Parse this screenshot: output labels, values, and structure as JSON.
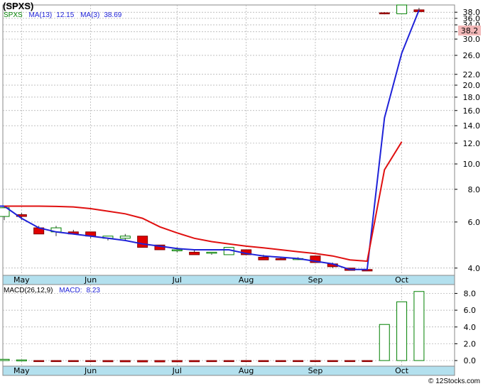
{
  "header": {
    "symbol": "(SPXS)",
    "legend_symbol": "SPXS",
    "ma13_label": "MA(13)",
    "ma13_value": "12.15",
    "ma3_label": "MA(3)",
    "ma3_value": "38.69"
  },
  "macd_header": {
    "label": "MACD(26,12,9)",
    "macd_label": "MACD:",
    "macd_value": "8.23"
  },
  "price_badge": "38.2",
  "credit": "© 12Stocks.com",
  "colors": {
    "up": "#ffffff",
    "up_border": "#008000",
    "down": "#e00000",
    "ma13": "#e01010",
    "ma3": "#1f22d8",
    "axis_band": "#b3e0ee",
    "grid": "#aaaaaa",
    "badge_bg": "#f2b8b8"
  },
  "chart_data": [
    {
      "type": "candlestick",
      "title": "(SPXS)",
      "y_scale": "log",
      "ylim": [
        3.8,
        40
      ],
      "y_ticks": [
        4.0,
        6.0,
        8.0,
        10.0,
        12.0,
        14.0,
        16.0,
        18.0,
        20.0,
        22.0,
        26.0,
        30.0,
        32.0,
        34.0,
        36.0,
        38.0
      ],
      "x_labels": [
        "May",
        "Jun",
        "Jul",
        "Aug",
        "Sep",
        "Oct"
      ],
      "x_label_index": [
        1,
        5,
        10,
        14,
        18,
        23
      ],
      "grid": "dashed",
      "candles": [
        {
          "o": 6.3,
          "h": 6.9,
          "l": 6.1,
          "c": 6.8
        },
        {
          "o": 6.4,
          "h": 6.5,
          "l": 6.1,
          "c": 6.3
        },
        {
          "o": 5.7,
          "h": 5.8,
          "l": 5.4,
          "c": 5.4
        },
        {
          "o": 5.5,
          "h": 5.8,
          "l": 5.3,
          "c": 5.7
        },
        {
          "o": 5.5,
          "h": 5.6,
          "l": 5.4,
          "c": 5.4
        },
        {
          "o": 5.5,
          "h": 5.5,
          "l": 5.2,
          "c": 5.3
        },
        {
          "o": 5.2,
          "h": 5.3,
          "l": 5.1,
          "c": 5.3
        },
        {
          "o": 5.2,
          "h": 5.4,
          "l": 5.1,
          "c": 5.3
        },
        {
          "o": 5.3,
          "h": 5.3,
          "l": 4.8,
          "c": 4.8
        },
        {
          "o": 4.9,
          "h": 4.9,
          "l": 4.7,
          "c": 4.7
        },
        {
          "o": 4.7,
          "h": 4.8,
          "l": 4.6,
          "c": 4.7
        },
        {
          "o": 4.6,
          "h": 4.7,
          "l": 4.5,
          "c": 4.5
        },
        {
          "o": 4.6,
          "h": 4.6,
          "l": 4.5,
          "c": 4.6
        },
        {
          "o": 4.5,
          "h": 4.8,
          "l": 4.5,
          "c": 4.8
        },
        {
          "o": 4.7,
          "h": 4.7,
          "l": 4.5,
          "c": 4.5
        },
        {
          "o": 4.4,
          "h": 4.5,
          "l": 4.3,
          "c": 4.3
        },
        {
          "o": 4.35,
          "h": 4.4,
          "l": 4.3,
          "c": 4.3
        },
        {
          "o": 4.35,
          "h": 4.4,
          "l": 4.3,
          "c": 4.35
        },
        {
          "o": 4.45,
          "h": 4.45,
          "l": 4.2,
          "c": 4.2
        },
        {
          "o": 4.15,
          "h": 4.2,
          "l": 4.0,
          "c": 4.05
        },
        {
          "o": 4.0,
          "h": 4.0,
          "l": 3.92,
          "c": 3.92
        },
        {
          "o": 3.95,
          "h": 3.95,
          "l": 3.9,
          "c": 3.9
        },
        {
          "o": 37.8,
          "h": 38.0,
          "l": 37.3,
          "c": 37.5
        },
        {
          "o": 37.5,
          "h": 40.5,
          "l": 37.5,
          "c": 40.5
        },
        {
          "o": 38.8,
          "h": 39.5,
          "l": 38.0,
          "c": 38.2
        }
      ],
      "ma13": [
        6.9,
        6.9,
        6.9,
        6.88,
        6.85,
        6.75,
        6.6,
        6.45,
        6.2,
        5.75,
        5.45,
        5.2,
        5.05,
        4.95,
        4.85,
        4.78,
        4.7,
        4.62,
        4.55,
        4.45,
        4.3,
        4.25,
        9.5,
        12.15
      ],
      "ma13_start": 0,
      "ma3": [
        6.9,
        6.9,
        6.2,
        5.7,
        5.5,
        5.4,
        5.3,
        5.2,
        5.1,
        4.95,
        4.85,
        4.75,
        4.7,
        4.7,
        4.7,
        4.55,
        4.45,
        4.4,
        4.35,
        4.25,
        4.15,
        3.95,
        3.95,
        15.0,
        26.5,
        38.69
      ],
      "ma3_start": -1,
      "last_price": 38.2
    },
    {
      "type": "bar",
      "title": "MACD(26,12,9)",
      "ylim": [
        -0.5,
        8.8
      ],
      "y_ticks": [
        0.0,
        2.0,
        4.0,
        6.0,
        8.0
      ],
      "x_labels": [
        "May",
        "Jun",
        "Jul",
        "Aug",
        "Sep",
        "Oct"
      ],
      "x_label_index": [
        1,
        5,
        10,
        14,
        18,
        23
      ],
      "values": [
        0.15,
        0.08,
        -0.03,
        -0.06,
        -0.1,
        -0.12,
        -0.14,
        -0.15,
        -0.16,
        -0.16,
        -0.15,
        -0.14,
        -0.13,
        -0.12,
        -0.11,
        -0.1,
        -0.09,
        -0.08,
        -0.07,
        -0.06,
        -0.05,
        -0.04,
        4.3,
        7.0,
        8.23
      ]
    }
  ]
}
